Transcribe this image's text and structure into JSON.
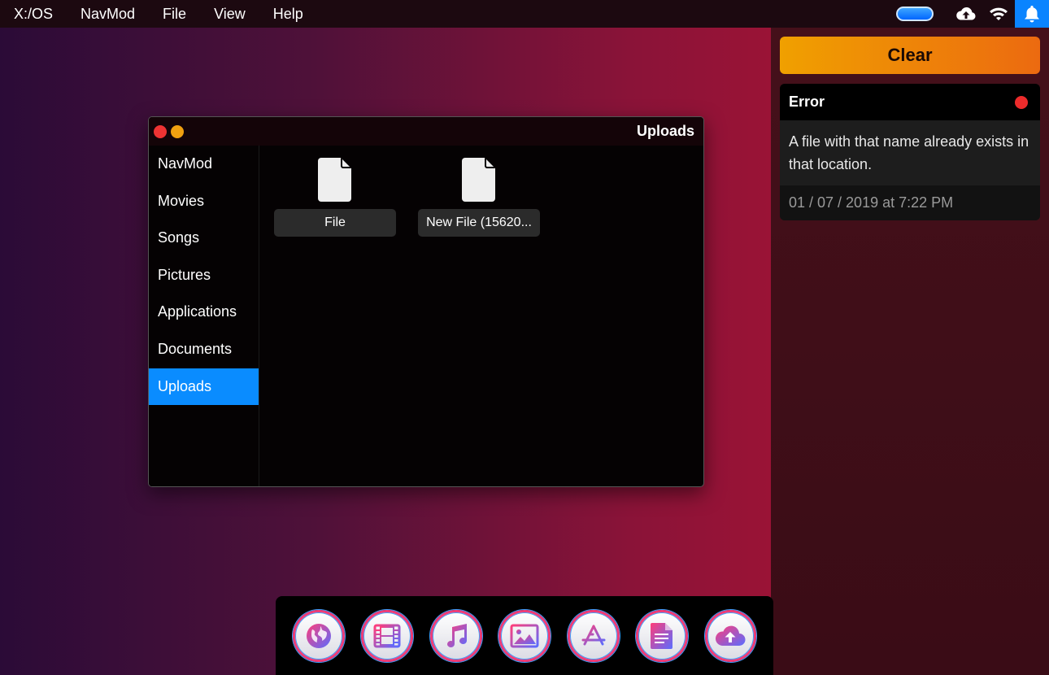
{
  "menubar": {
    "items": [
      "X:/OS",
      "NavMod",
      "File",
      "View",
      "Help"
    ],
    "icons": [
      "battery-icon",
      "cloud-upload-icon",
      "wifi-icon",
      "bell-icon"
    ]
  },
  "notifications": {
    "clear_label": "Clear",
    "items": [
      {
        "title": "Error",
        "message": "A file with that name already exists in that location.",
        "time": "01 / 07 / 2019 at 7:22 PM",
        "status_color": "#ec2b2b"
      }
    ]
  },
  "window": {
    "title": "Uploads",
    "sidebar": {
      "items": [
        "NavMod",
        "Movies",
        "Songs",
        "Pictures",
        "Applications",
        "Documents",
        "Uploads"
      ],
      "active": "Uploads"
    },
    "files": [
      {
        "name": "File"
      },
      {
        "name": "New File (15620..."
      }
    ]
  },
  "dock": {
    "apps": [
      "globe-icon",
      "film-icon",
      "music-icon",
      "picture-icon",
      "app-store-icon",
      "document-icon",
      "cloud-upload-icon"
    ]
  },
  "colors": {
    "accent": "#0a8cff",
    "clear_gradient_start": "#f0a000",
    "clear_gradient_end": "#ec6a10",
    "dock_ring": "#ef3d78"
  }
}
